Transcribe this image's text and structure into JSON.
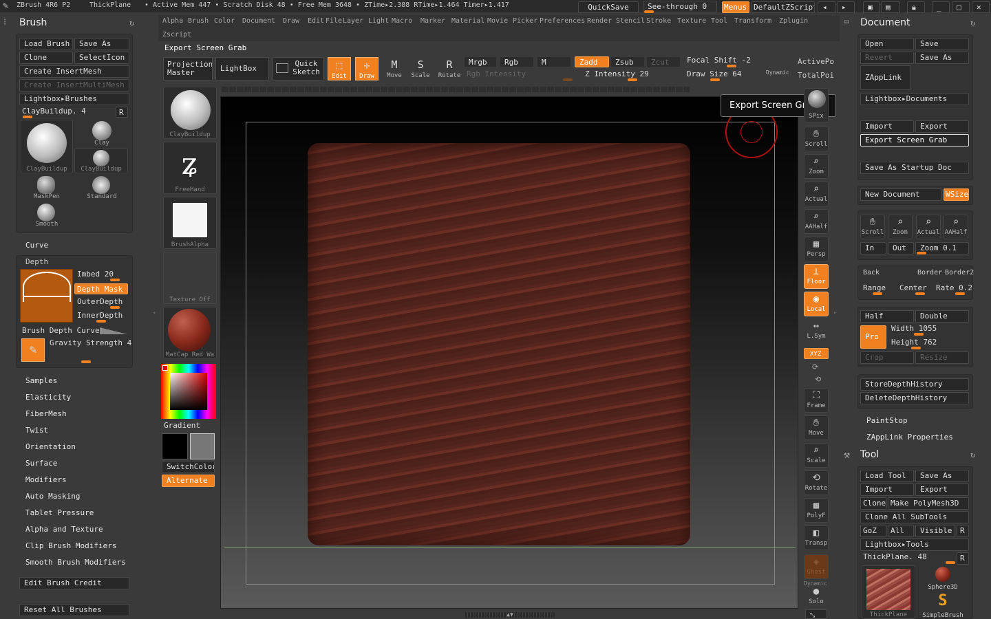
{
  "topbar": {
    "app": "ZBrush 4R6 P2",
    "doc": "ThickPlane",
    "mem": "• Active Mem 447 • Scratch Disk 48 • Free Mem 3648 • ZTime▸2.388 RTime▸1.464 Timer▸1.417",
    "quicksave": "QuickSave",
    "seethrough": "See-through  0",
    "menus": "Menus",
    "script": "DefaultZScript"
  },
  "menubar": [
    "Alpha",
    "Brush",
    "Color",
    "Document",
    "Draw",
    "Edit",
    "File",
    "Layer",
    "Light",
    "Macro",
    "Marker",
    "Material",
    "Movie",
    "Picker",
    "Preferences",
    "Render",
    "Stencil",
    "Stroke",
    "Texture",
    "Tool",
    "Transform",
    "Zplugin",
    "Zscript"
  ],
  "status_line": "Export Screen Grab",
  "toolbar": {
    "projection": "Projection Master",
    "lightbox": "LightBox",
    "quicksketch": "Quick Sketch",
    "edit": "Edit",
    "draw": "Draw",
    "move": "Move",
    "scale": "Scale",
    "rotate": "Rotate",
    "mrgb": "Mrgb",
    "rgb": "Rgb",
    "m": "M",
    "zadd": "Zadd",
    "zsub": "Zsub",
    "zcut": "Zcut",
    "rgb_intensity": "Rgb Intensity",
    "z_intensity": "Z Intensity 29",
    "focal_shift": "Focal Shift -2",
    "draw_size": "Draw Size 64",
    "dynamic": "Dynamic",
    "activepoints": "ActivePo",
    "totalpoints": "TotalPoi"
  },
  "tooltip": "Export Screen Grab",
  "brush_panel": {
    "title": "Brush",
    "load": "Load Brush",
    "saveas": "Save As",
    "clone": "Clone",
    "selecticon": "SelectIcon",
    "create_insert": "Create InsertMesh",
    "create_multi": "Create InsertMultiMesh",
    "lightbox_brushes": "Lightbox▸Brushes",
    "current": "ClayBuildup. 4",
    "r": "R",
    "brushes": [
      {
        "name": "ClayBuildup"
      },
      {
        "name": "Clay"
      },
      {
        "name": "ClayBuildup"
      },
      {
        "name": "MaskPen"
      },
      {
        "name": "Standard"
      },
      {
        "name": "Smooth"
      }
    ],
    "curve": "Curve",
    "depth": "Depth",
    "imbed": "Imbed 20",
    "depth_mask": "Depth Mask",
    "outer": "OuterDepth",
    "inner": "InnerDepth",
    "depth_curve": "Brush Depth Curve",
    "gravity": "Gravity Strength 4",
    "sections": [
      "Samples",
      "Elasticity",
      "FiberMesh",
      "Twist",
      "Orientation",
      "Surface",
      "Modifiers",
      "Auto Masking",
      "Tablet Pressure",
      "Alpha and Texture",
      "Clip Brush Modifiers",
      "Smooth Brush Modifiers"
    ],
    "edit_credit": "Edit Brush Credit",
    "reset": "Reset All Brushes"
  },
  "tray": {
    "brush": "ClayBuildup",
    "stroke": "FreeHand",
    "alpha": "BrushAlpha",
    "texture": "Texture Off",
    "material": "MatCap Red Wa",
    "gradient": "Gradient",
    "switch": "SwitchColor",
    "alternate": "Alternate"
  },
  "shelf": [
    "SPix",
    "Scroll",
    "Zoom",
    "Actual",
    "AAHalf",
    "Persp",
    "Floor",
    "Local",
    "L.Sym",
    "XYZ",
    "Frame",
    "Move",
    "Scale",
    "Rotate",
    "PolyF",
    "Transp",
    "Ghost",
    "Solo",
    "Dynamic"
  ],
  "document_panel": {
    "title": "Document",
    "open": "Open",
    "save": "Save",
    "revert": "Revert",
    "saveas": "Save As",
    "zapplink": "ZAppLink",
    "lightbox_docs": "Lightbox▸Documents",
    "import": "Import",
    "export": "Export",
    "export_grab": "Export Screen Grab",
    "save_startup": "Save As Startup Doc",
    "new_doc": "New Document",
    "wsize": "WSize",
    "scroll": "Scroll",
    "zoom": "Zoom",
    "actual": "Actual",
    "aahalf": "AAHalf",
    "in": "In",
    "out": "Out",
    "zoomval": "Zoom 0.1",
    "back": "Back",
    "border": "Border",
    "border2": "Border2",
    "range": "Range",
    "center": "Center",
    "rate": "Rate 0.2",
    "half": "Half",
    "double": "Double",
    "pro": "Pro",
    "width": "Width 1055",
    "height": "Height 762",
    "crop": "Crop",
    "resize": "Resize",
    "store": "StoreDepthHistory",
    "delete": "DeleteDepthHistory",
    "paintstop": "PaintStop",
    "zapp_props": "ZAppLink Properties"
  },
  "tool_panel": {
    "title": "Tool",
    "load": "Load Tool",
    "saveas": "Save As",
    "import": "Import",
    "export": "Export",
    "clone": "Clone",
    "makepoly": "Make PolyMesh3D",
    "cloneall": "Clone All SubTools",
    "goz": "GoZ",
    "all": "All",
    "visible": "Visible",
    "r": "R",
    "lightbox_tools": "Lightbox▸Tools",
    "current": "ThickPlane. 48",
    "sphere": "Sphere3D",
    "thick": "ThickPlane",
    "simple": "SimpleBrush"
  },
  "colors": {
    "accent": "#f08020",
    "canvas_obj": "#5a2a22"
  }
}
